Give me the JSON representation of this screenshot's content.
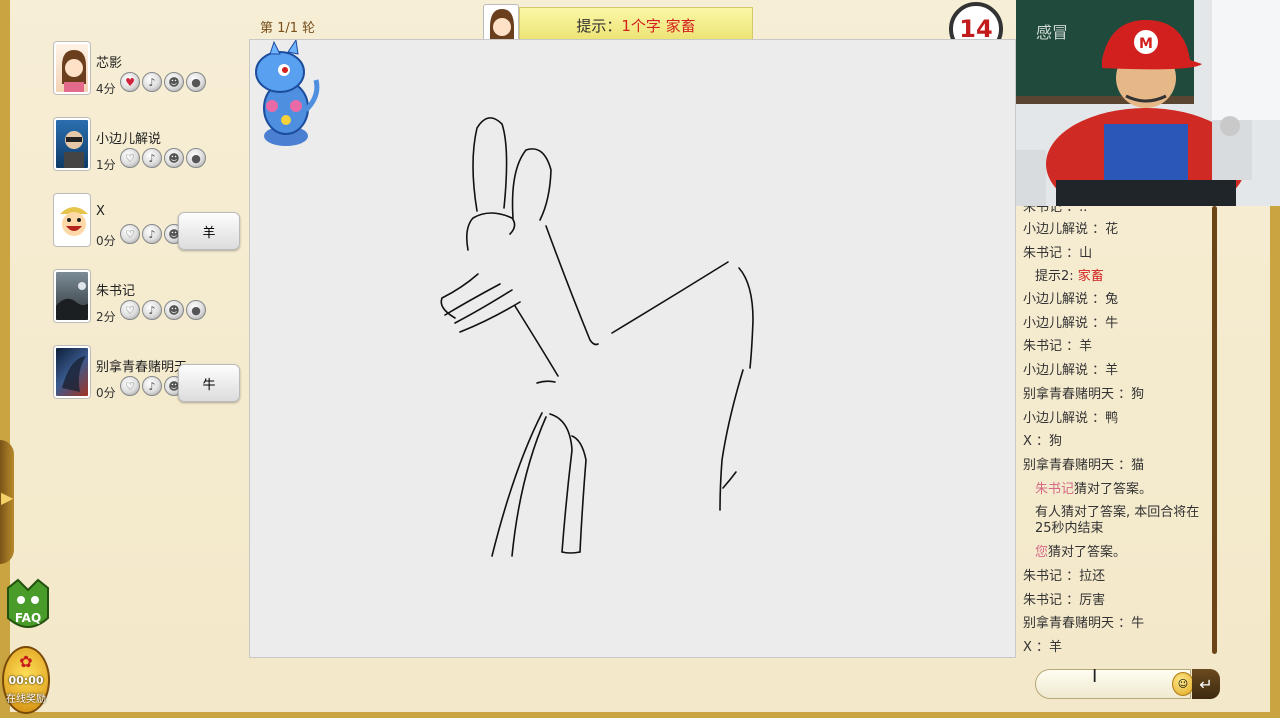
{
  "round": {
    "label": "第 1/1 轮"
  },
  "hint": {
    "label": "提示：",
    "text": "1个字 家畜"
  },
  "timer": {
    "value": "14"
  },
  "players": [
    {
      "name": "芯影",
      "score": "4分"
    },
    {
      "name": "小边儿解说",
      "score": "1分"
    },
    {
      "name": "X",
      "score": "0分",
      "guess": "羊"
    },
    {
      "name": "朱书记",
      "score": "2分"
    },
    {
      "name": "别拿青春赌明天",
      "score": "0分",
      "guess": "牛"
    }
  ],
  "chat": {
    "lines": [
      {
        "text": "朱书记 ：.."
      },
      {
        "text": "小边儿解说 ：花"
      },
      {
        "text": "朱书记 ：山"
      },
      {
        "prefix": "提示2: ",
        "highlight": "家畜"
      },
      {
        "text": "小边儿解说 ：兔"
      },
      {
        "text": "小边儿解说 ：牛"
      },
      {
        "text": "朱书记 ：羊"
      },
      {
        "text": "小边儿解说 ：羊"
      },
      {
        "text": "别拿青春赌明天 ：狗"
      },
      {
        "text": "小边儿解说 ：鸭"
      },
      {
        "text": "X ：狗"
      },
      {
        "text": "别拿青春赌明天 ：猫"
      },
      {
        "highlight": "朱书记",
        "suffix": "猜对了答案。"
      },
      {
        "text": "有人猜对了答案, 本回合将在25秒内结束"
      },
      {
        "highlight": "您",
        "suffix": "猜对了答案。"
      },
      {
        "text": "朱书记 ：拉还"
      },
      {
        "text": "朱书记 ：厉害"
      },
      {
        "text": "别拿青春赌明天 ：牛"
      },
      {
        "text": "X ：羊"
      }
    ]
  },
  "faq": {
    "label": "FAQ"
  },
  "reward": {
    "time": "00:00",
    "label": "在线奖励"
  },
  "webcam": {
    "board_text": "感冒"
  },
  "colors": {
    "accent_red": "#d2201f",
    "hint_bg": "#f2ea8a",
    "frame_gold": "#c9a441"
  }
}
